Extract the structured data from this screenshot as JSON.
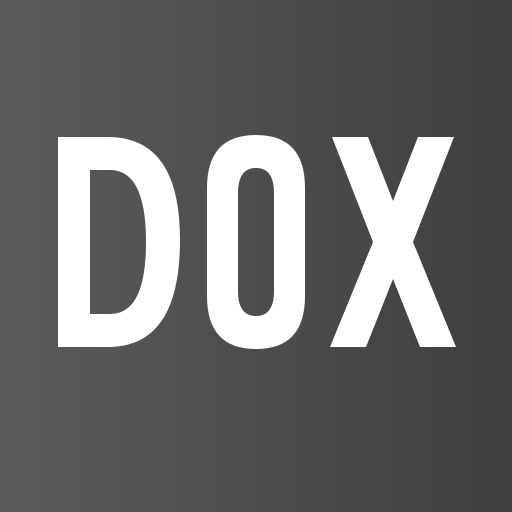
{
  "logo": {
    "text": "DOX",
    "background_start": "#5b5b5b",
    "background_end": "#3f3f3f",
    "text_color": "#ffffff"
  }
}
